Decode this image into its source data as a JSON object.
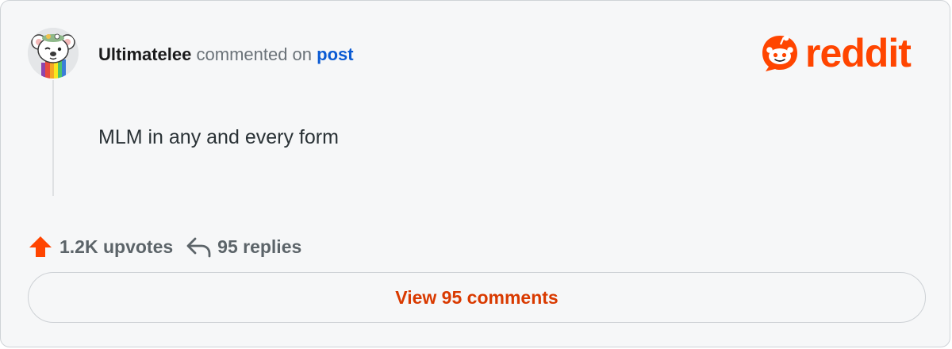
{
  "comment": {
    "username": "Ultimatelee",
    "action_text": " commented on ",
    "post_link_label": "post",
    "body": "MLM in any and every form"
  },
  "brand": {
    "logo_word": "reddit",
    "color": "#ff4500"
  },
  "stats": {
    "upvotes_label": "1.2K upvotes",
    "replies_label": "95 replies",
    "upvote_icon": "upvote-arrow-icon",
    "reply_icon": "reply-arrow-icon"
  },
  "footer": {
    "view_comments_label": "View 95 comments"
  },
  "colors": {
    "accent_orange": "#ff4500",
    "link_blue": "#0b5bd3",
    "button_text": "#d93a00"
  }
}
